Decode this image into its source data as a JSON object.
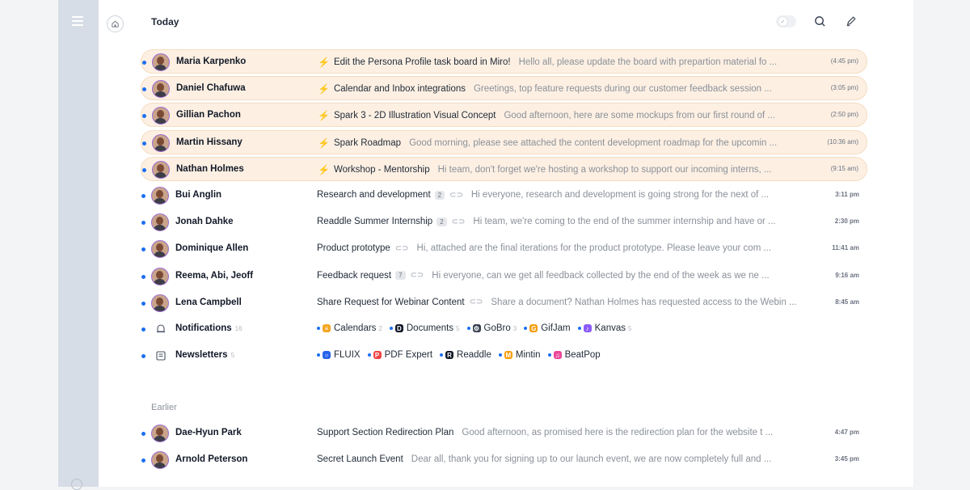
{
  "header": {
    "title": "Today"
  },
  "pinned": [
    {
      "sender": "Maria Karpenko",
      "subject": "Edit the Persona Profile task board in Miro!",
      "preview": "Hello all, please update the board with prepartion material fo ...",
      "time": "(4:45 pm)"
    },
    {
      "sender": "Daniel Chafuwa",
      "subject": "Calendar and Inbox integrations",
      "preview": "Greetings, top feature requests during our customer feedback session ...",
      "time": "(3:05 pm)"
    },
    {
      "sender": "Gillian Pachon",
      "subject": "Spark 3 - 2D Illustration Visual Concept",
      "preview": "Good afternoon, here are some mockups from our first round of ...",
      "time": "(2:50 pm)"
    },
    {
      "sender": "Martin Hissany",
      "subject": "Spark Roadmap",
      "preview": "Good morning, please see attached the content development roadmap for the upcomin ...",
      "time": "(10:36 am)"
    },
    {
      "sender": "Nathan Holmes",
      "subject": "Workshop - Mentorship",
      "preview": "Hi team, don't forget we're hosting a workshop to support our incoming interns, ...",
      "time": "(9:15 am)"
    }
  ],
  "today": [
    {
      "sender": "Bui Anglin",
      "subject": "Research and development",
      "badge": "2",
      "preview": "Hi everyone, research and development is going strong for the next  of ...",
      "time": "3:11 pm"
    },
    {
      "sender": "Jonah Dahke",
      "subject": "Readdle Summer Internship",
      "badge": "2",
      "preview": "Hi team, we're coming to the end of the summer internship and have or ...",
      "time": "2:30 pm"
    },
    {
      "sender": "Dominique Allen",
      "subject": "Product prototype",
      "badge": "",
      "preview": "Hi, attached are the final iterations for the product prototype. Please leave your com ...",
      "time": "11:41 am"
    },
    {
      "sender": "Reema, Abi, Jeoff",
      "subject": "Feedback request",
      "badge": "7",
      "preview": "Hi everyone, can we get all feedback collected by the end of the week as we ne ...",
      "time": "9:16 am"
    },
    {
      "sender": "Lena Campbell",
      "subject": "Share Request for Webinar Content",
      "badge": "",
      "preview": "Share a document? Nathan Holmes has requested access to the Webin ...",
      "time": "8:45 am"
    }
  ],
  "notifications": {
    "label": "Notifications",
    "count": "16",
    "items": [
      {
        "name": "Calendars",
        "count": "2",
        "color": "#f5a623",
        "glyph": "≡"
      },
      {
        "name": "Documents",
        "count": "5",
        "color": "#111827",
        "glyph": "D"
      },
      {
        "name": "GoBro",
        "count": "3",
        "color": "#374151",
        "glyph": "⚙"
      },
      {
        "name": "GifJam",
        "count": "",
        "color": "#f59e0b",
        "glyph": "G"
      },
      {
        "name": "Kanvas",
        "count": "5",
        "color": "#8b5cf6",
        "glyph": "♪"
      }
    ]
  },
  "newsletters": {
    "label": "Newsletters",
    "count": "5",
    "items": [
      {
        "name": "FLUIX",
        "color": "#2563eb",
        "glyph": "○"
      },
      {
        "name": "PDF Expert",
        "color": "#ef4444",
        "glyph": "P"
      },
      {
        "name": "Readdle",
        "color": "#111827",
        "glyph": "R"
      },
      {
        "name": "Mintin",
        "color": "#f59e0b",
        "glyph": "M"
      },
      {
        "name": "BeatPop",
        "color": "#ec4899",
        "glyph": "♫"
      }
    ]
  },
  "earlier_label": "Earlier",
  "earlier": [
    {
      "sender": "Dae-Hyun Park",
      "subject": "Support Section Redirection Plan",
      "preview": "Good afternoon, as promised here is the redirection plan for the website t ...",
      "time": "4:47 pm"
    },
    {
      "sender": "Arnold Peterson",
      "subject": "Secret Launch Event",
      "preview": "Dear all, thank you for signing up to our launch event, we are now completely full and  ...",
      "time": "3:45 pm"
    }
  ]
}
